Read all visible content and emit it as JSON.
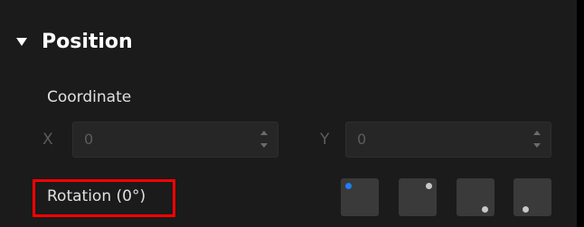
{
  "section": {
    "title": "Position",
    "expanded": true
  },
  "coordinate": {
    "label": "Coordinate",
    "x": {
      "axis": "X",
      "value": "0"
    },
    "y": {
      "axis": "Y",
      "value": "0"
    }
  },
  "rotation": {
    "label": "Rotation (0°)",
    "highlighted": true,
    "highlight_color": "#ff0000"
  },
  "anchor_buttons": [
    {
      "name": "top-left",
      "selected": true
    },
    {
      "name": "top-right",
      "selected": false
    },
    {
      "name": "bottom-right",
      "selected": false
    },
    {
      "name": "bottom-left",
      "selected": false
    }
  ],
  "colors": {
    "background": "#1b1b1b",
    "accent": "#1e7ff5",
    "text": "#e0e0e0",
    "disabled_text": "#5c5c5c"
  }
}
